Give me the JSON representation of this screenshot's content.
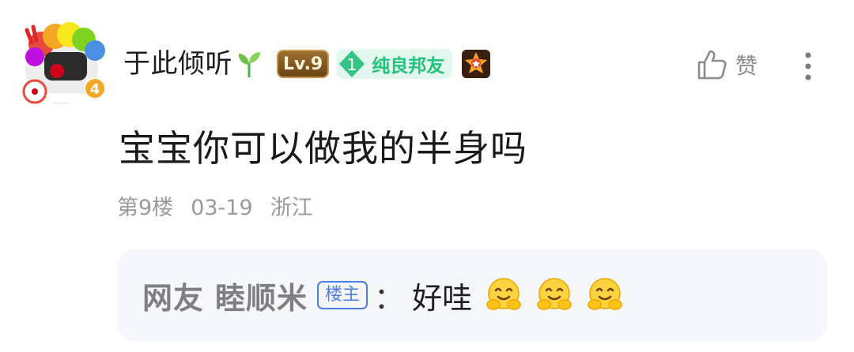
{
  "user": {
    "name": "于此倾听",
    "level": "Lv.9",
    "fan_level": "1",
    "fan_title": "纯良邦友",
    "avatar_badge_number": "4"
  },
  "actions": {
    "like_label": "赞"
  },
  "post": {
    "content": "宝宝你可以做我的半身吗",
    "floor": "第9楼",
    "date": "03-19",
    "location": "浙江"
  },
  "reply": {
    "prefix": "网友",
    "author": "睦顺米",
    "op_tag": "楼主",
    "colon": "：",
    "text": "好哇"
  }
}
